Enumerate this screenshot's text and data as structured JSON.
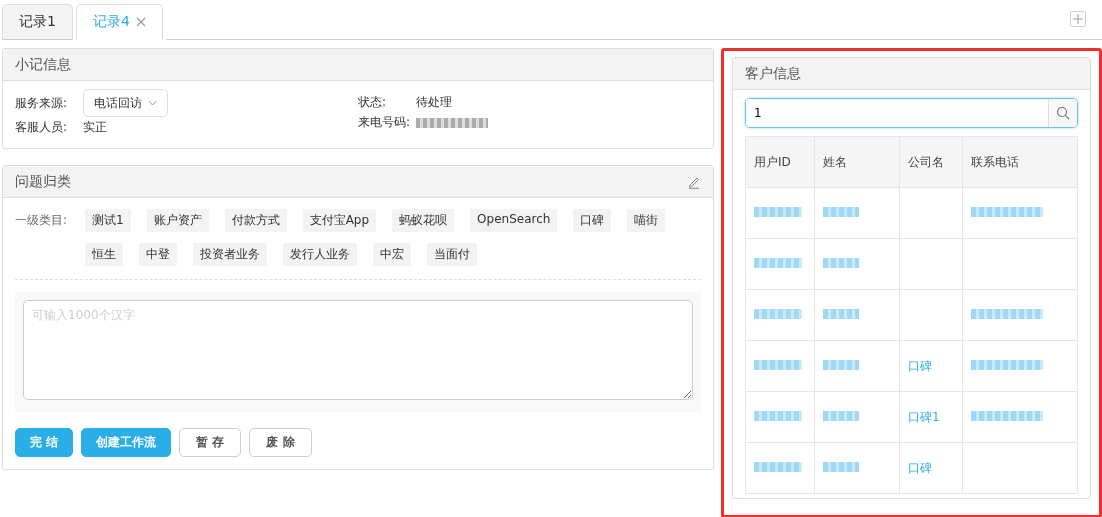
{
  "tabs": [
    {
      "label": "记录1",
      "selected": false,
      "closable": false
    },
    {
      "label": "记录4",
      "selected": true,
      "closable": true
    }
  ],
  "note_panel": {
    "title": "小记信息",
    "service_source": {
      "label": "服务来源:",
      "value": "电话回访"
    },
    "agent": {
      "label": "客服人员:",
      "value": "实正"
    },
    "status": {
      "label": "状态:",
      "value": "待处理"
    },
    "caller_number": {
      "label": "来电号码:",
      "blurred": true
    }
  },
  "category_panel": {
    "title": "问题归类",
    "level_label": "一级类目:",
    "tags": [
      "测试1",
      "账户资产",
      "付款方式",
      "支付宝App",
      "蚂蚁花呗",
      "OpenSearch",
      "口碑",
      "喵街",
      "恒生",
      "中登",
      "投资者业务",
      "发行人业务",
      "中宏",
      "当面付"
    ],
    "note_placeholder": "可输入1000个汉字",
    "buttons": [
      {
        "label": "完 结",
        "kind": "primary"
      },
      {
        "label": "创建工作流",
        "kind": "primary"
      },
      {
        "label": "暂 存",
        "kind": "default"
      },
      {
        "label": "废 除",
        "kind": "default"
      }
    ]
  },
  "customer_panel": {
    "title": "客户信息",
    "highlighted": true,
    "search_value": "1",
    "columns": [
      "用户ID",
      "姓名",
      "公司名",
      "联系电话"
    ],
    "rows": [
      {
        "user_id_blurred": true,
        "name_blurred": true,
        "phone_blurred": true
      },
      {
        "user_id_blurred": true,
        "name_blurred": true,
        "phone_blurred": false
      },
      {
        "user_id_blurred": true,
        "name_blurred": true,
        "phone_blurred": true
      },
      {
        "user_id_blurred": true,
        "name_blurred": true,
        "company": "口碑",
        "phone_blurred": true
      },
      {
        "user_id_blurred": true,
        "name_blurred": true,
        "company": "口碑1",
        "phone_blurred": true
      },
      {
        "user_id_blurred": true,
        "name_blurred": true,
        "company": "口碑",
        "phone_blurred": false
      }
    ]
  }
}
